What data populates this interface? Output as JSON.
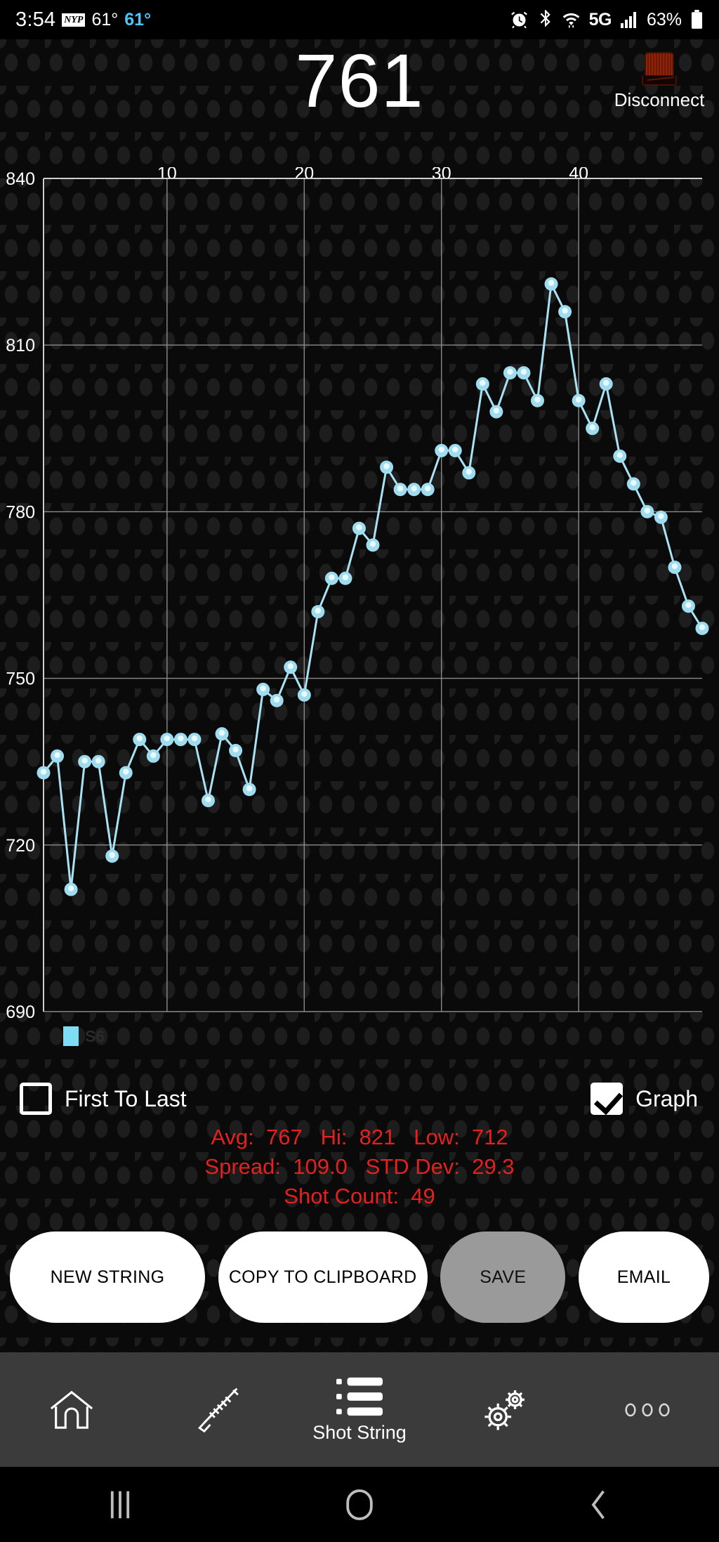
{
  "status_bar": {
    "clock": "3:54",
    "news_badge": "NYP",
    "temp_primary": "61°",
    "temp_secondary": "61°",
    "alarm_icon": "alarm-icon",
    "bluetooth_icon": "bluetooth-icon",
    "wifi_icon": "wifi-icon",
    "network_label": "5G",
    "signal_icon": "signal-bars-icon",
    "battery_percent": "63%",
    "battery_icon": "battery-icon"
  },
  "header": {
    "reading": "761",
    "disconnect_label": "Disconnect",
    "disconnect_icon": "chronograph-device-icon",
    "disconnect_icon_color": "#7a1c08"
  },
  "chart_data": {
    "type": "line",
    "title": "",
    "xlabel": "",
    "ylabel": "",
    "xlim": [
      1,
      49
    ],
    "ylim": [
      690,
      840
    ],
    "grid": true,
    "legend_position": "bottom-left",
    "series_color": "#a8e2f3",
    "y_ticks": [
      840,
      810,
      780,
      750,
      720,
      690
    ],
    "x_ticks": [
      10,
      20,
      30,
      40
    ],
    "legend": [
      {
        "label": "S6",
        "color": "#7fdcf5"
      }
    ],
    "x": [
      1,
      2,
      3,
      4,
      5,
      6,
      7,
      8,
      9,
      10,
      11,
      12,
      13,
      14,
      15,
      16,
      17,
      18,
      19,
      20,
      21,
      22,
      23,
      24,
      25,
      26,
      27,
      28,
      29,
      30,
      31,
      32,
      33,
      34,
      35,
      36,
      37,
      38,
      39,
      40,
      41,
      42,
      43,
      44,
      45,
      46,
      47,
      48,
      49
    ],
    "values": [
      733,
      736,
      712,
      735,
      735,
      718,
      733,
      739,
      736,
      739,
      739,
      739,
      728,
      740,
      737,
      730,
      748,
      746,
      752,
      747,
      762,
      768,
      768,
      777,
      774,
      788,
      784,
      784,
      784,
      791,
      791,
      787,
      803,
      798,
      805,
      805,
      800,
      821,
      816,
      800,
      795,
      803,
      790,
      785,
      780,
      779,
      770,
      763,
      759
    ],
    "series": [
      {
        "name": "S6",
        "color": "#a8e2f3",
        "values": [
          733,
          736,
          712,
          735,
          735,
          718,
          733,
          739,
          736,
          739,
          739,
          739,
          728,
          740,
          737,
          730,
          748,
          746,
          752,
          747,
          762,
          768,
          768,
          777,
          774,
          788,
          784,
          784,
          784,
          791,
          791,
          787,
          803,
          798,
          805,
          805,
          800,
          821,
          816,
          800,
          795,
          803,
          790,
          785,
          780,
          779,
          770,
          763,
          759
        ]
      }
    ]
  },
  "controls": {
    "first_to_last": {
      "label": "First To Last",
      "checked": false
    },
    "graph": {
      "label": "Graph",
      "checked": true
    }
  },
  "stats": {
    "line1": "Avg:  767   Hi:  821   Low:  712",
    "line2": "Spread:  109.0   STD Dev:  29.3",
    "line3": "Shot Count:  49",
    "color": "#e5201e"
  },
  "actions": {
    "new_string": "NEW STRING",
    "copy_to_clipboard": "COPY TO CLIPBOARD",
    "save": "SAVE",
    "email": "EMAIL"
  },
  "tabbar": {
    "items": [
      {
        "label": "",
        "icon": "home-icon"
      },
      {
        "label": "",
        "icon": "rifle-icon"
      },
      {
        "label": "Shot String",
        "icon": "list-icon"
      },
      {
        "label": "",
        "icon": "gears-icon"
      },
      {
        "label": "",
        "icon": "overflow-dots-icon"
      }
    ]
  },
  "navbar": {
    "recents_icon": "recents-icon",
    "home_icon": "home-circle-icon",
    "back_icon": "back-chevron-icon"
  }
}
